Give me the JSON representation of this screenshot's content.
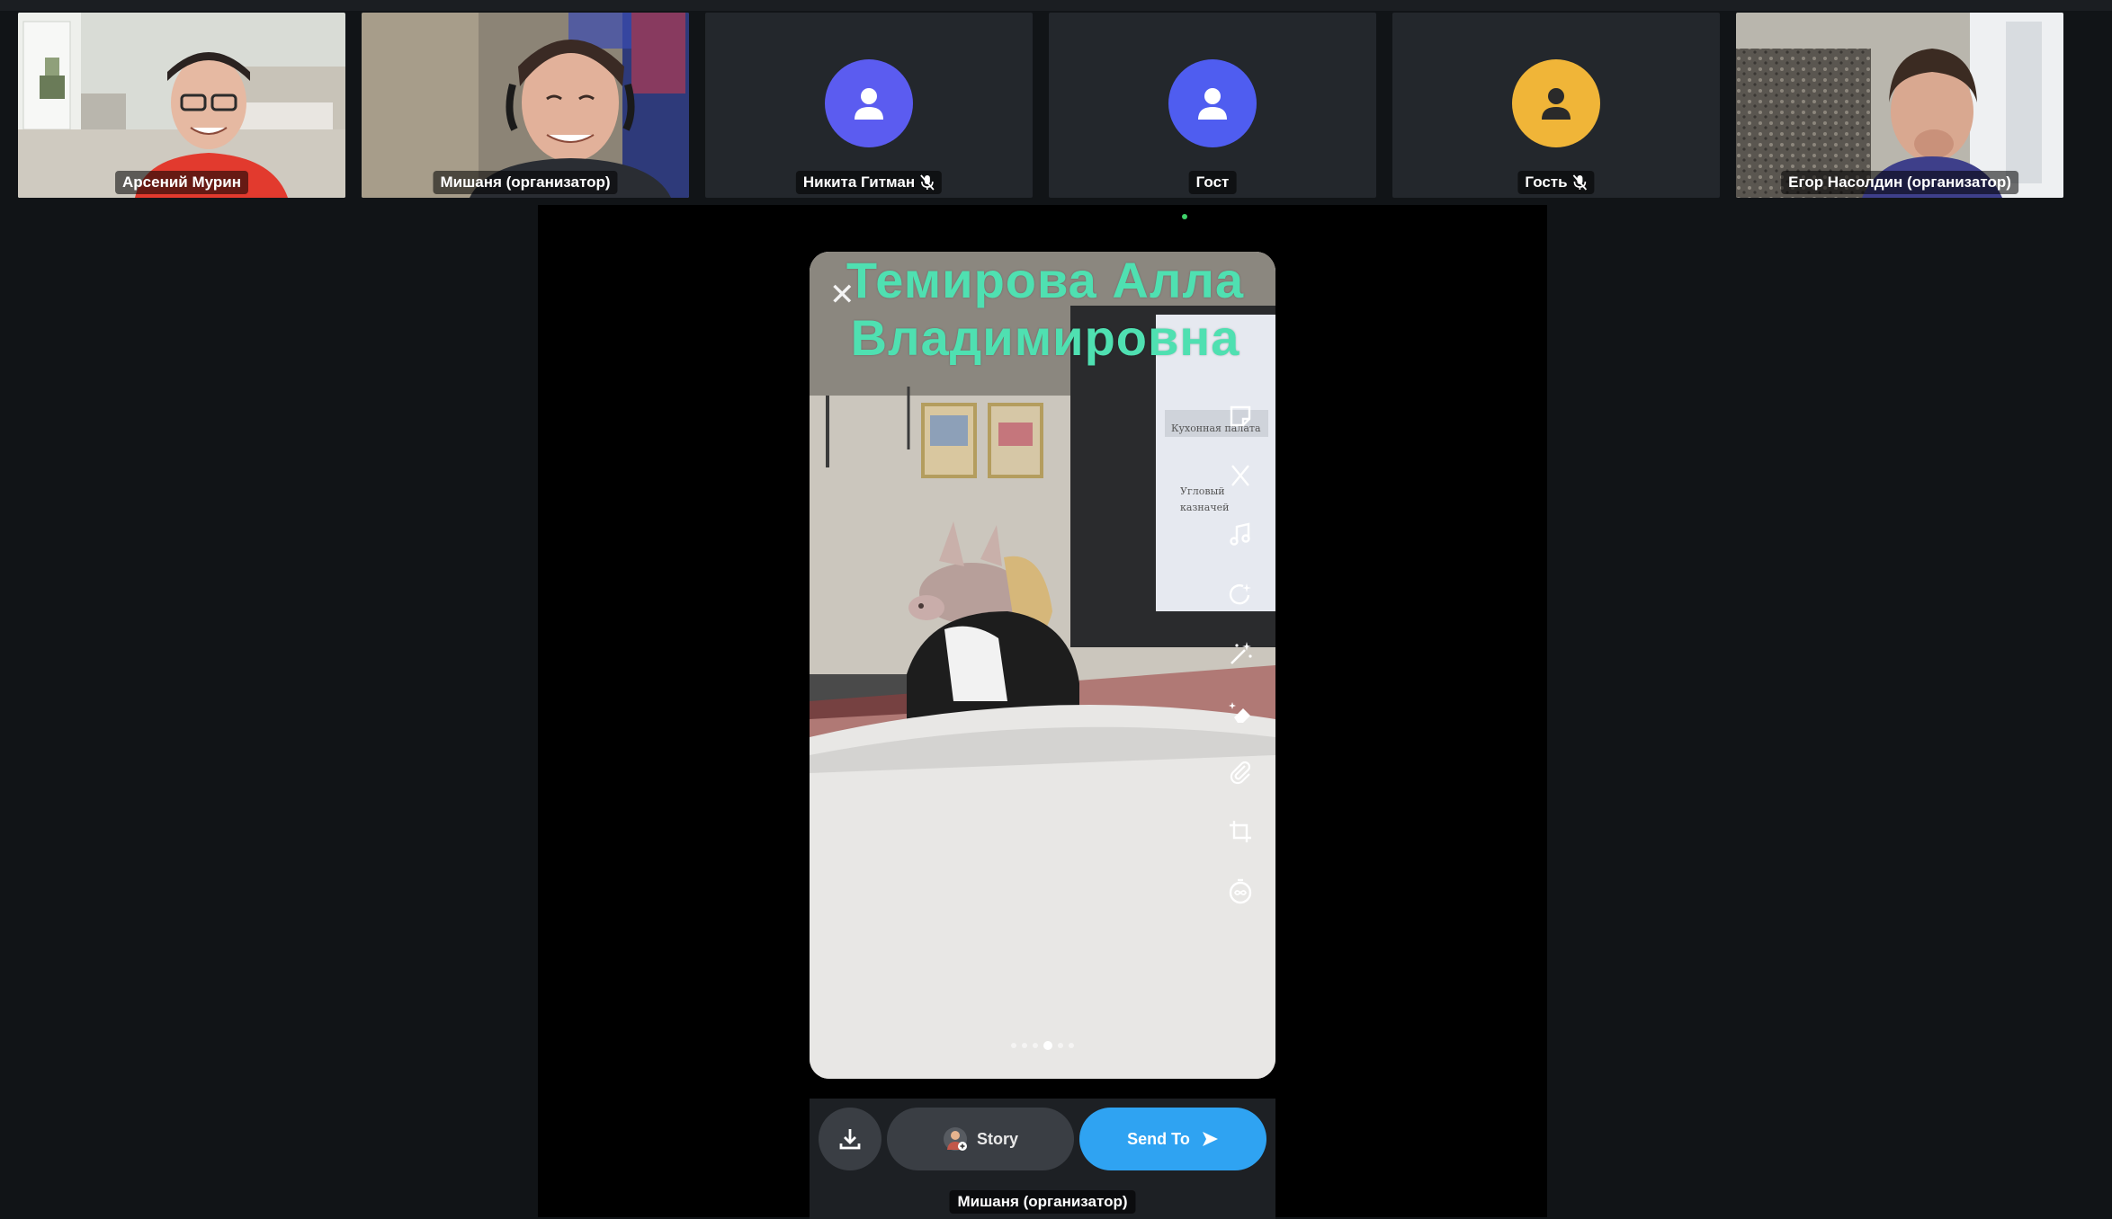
{
  "participants": [
    {
      "name": "Арсений Мурин",
      "type": "video"
    },
    {
      "name": "Мишаня (организатор)",
      "type": "video"
    },
    {
      "name": "Никита Гитман",
      "type": "avatar",
      "avatar_color": "#5b5cf0",
      "muted": true
    },
    {
      "name": "Гост",
      "type": "avatar",
      "avatar_color": "#4f5df0",
      "muted": false
    },
    {
      "name": "Гость",
      "type": "avatar",
      "avatar_color": "#f0b538",
      "muted": true
    },
    {
      "name": "Егор Насолдин (организатор)",
      "type": "video"
    }
  ],
  "shared_screen": {
    "overlay_text": "Темирова Алла Владимировна",
    "overlay_color": "#4fe0b1",
    "tools": [
      "sticker-icon",
      "scissors-icon",
      "music-note-icon",
      "refresh-sparkle-icon",
      "magic-wand-icon",
      "eraser-icon",
      "paperclip-icon",
      "crop-icon",
      "timer-loop-icon"
    ],
    "page_dots": 6,
    "active_dot": 3,
    "actions": {
      "story_label": "Story",
      "send_label": "Send To"
    },
    "accent": "#2fa3f2"
  },
  "presenter_label": "Мишаня (организатор)"
}
